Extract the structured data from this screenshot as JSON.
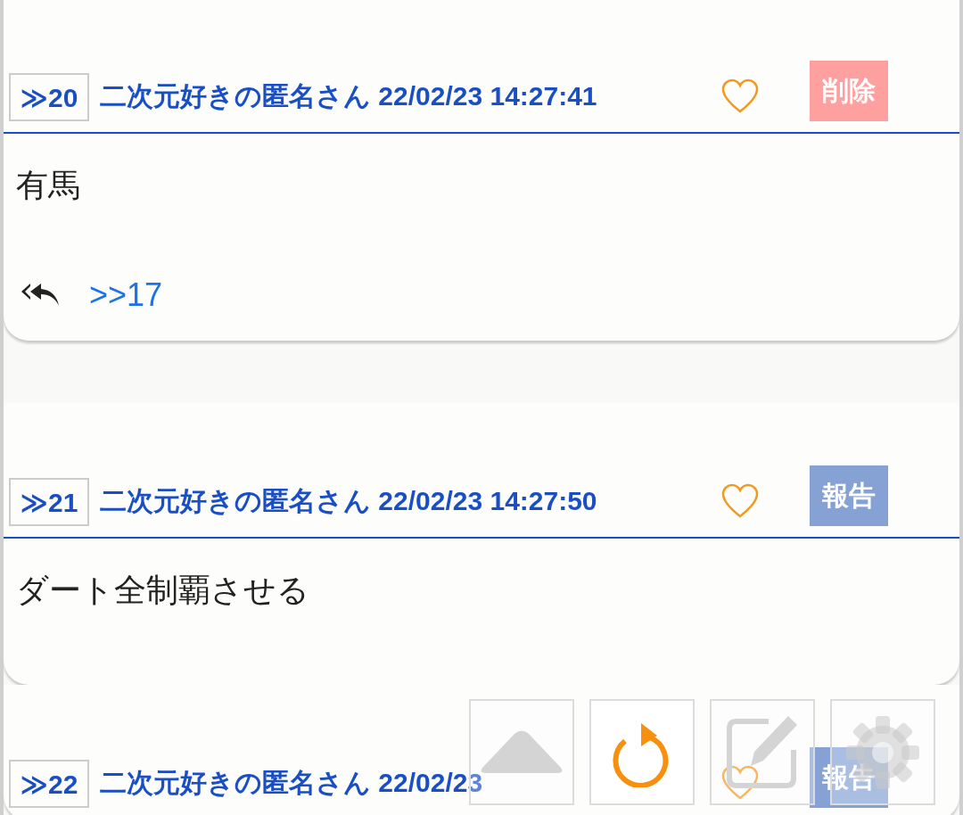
{
  "posts": [
    {
      "number": "≫20",
      "name": "二次元好きの匿名さん",
      "date": "22/02/23 14:27:41",
      "liked": false,
      "action": {
        "kind": "delete",
        "label": "削除"
      },
      "body": "有馬",
      "replies": [
        ">>17"
      ]
    },
    {
      "number": "≫21",
      "name": "二次元好きの匿名さん",
      "date": "22/02/23 14:27:50",
      "liked": false,
      "action": {
        "kind": "report",
        "label": "報告"
      },
      "body": "ダート全制覇させる"
    },
    {
      "number": "≫22",
      "name": "二次元好きの匿名さん",
      "date": "22/02/23",
      "liked": false,
      "action": {
        "kind": "report",
        "label": "報告"
      }
    }
  ]
}
